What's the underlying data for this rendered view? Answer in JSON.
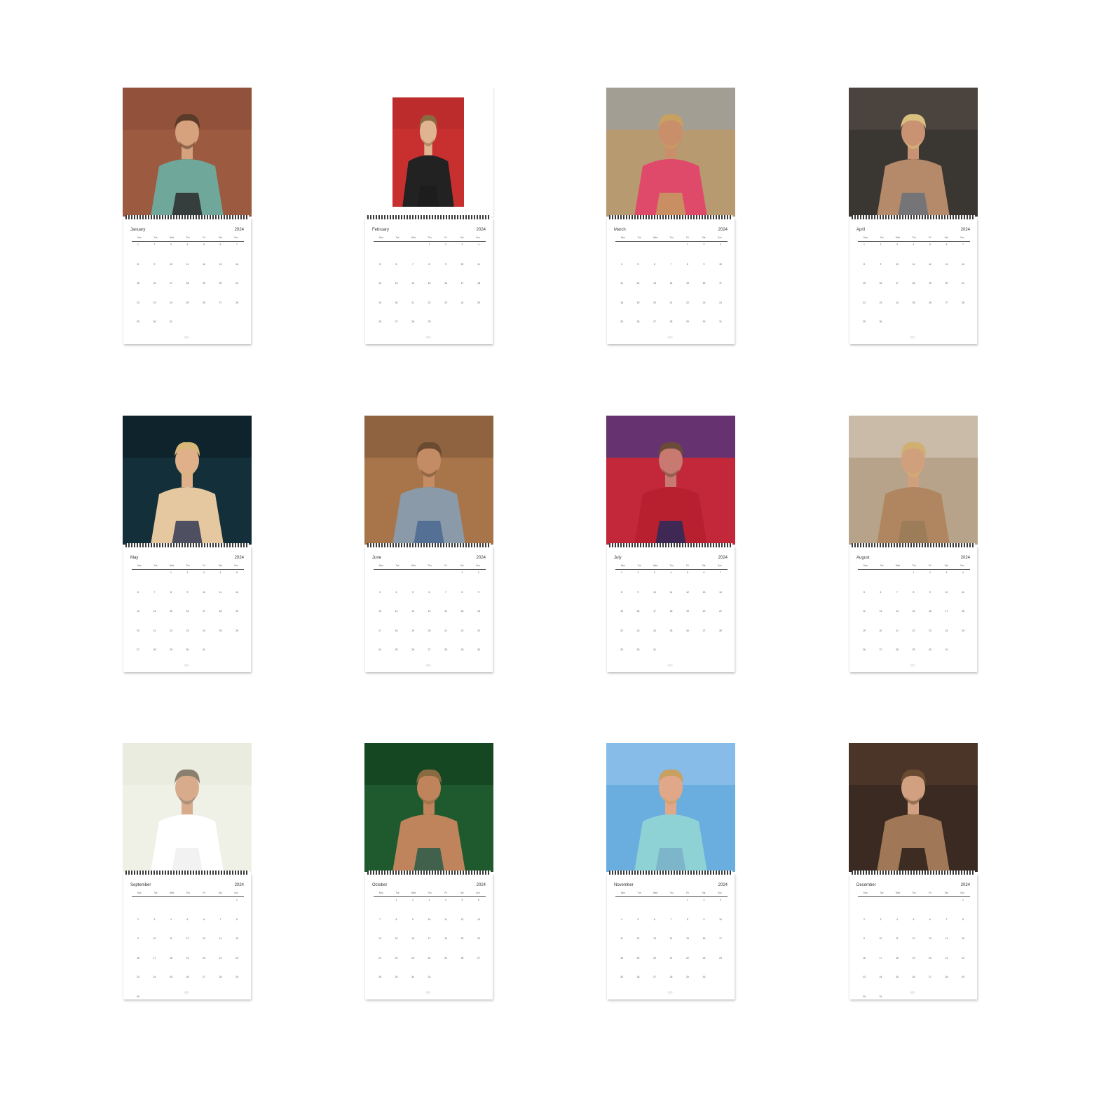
{
  "calendar": {
    "year_label": "2024",
    "weekdays": [
      "Mon",
      "Tue",
      "Wed",
      "Thu",
      "Fri",
      "Sat",
      "Sun"
    ],
    "months": [
      {
        "name": "January",
        "photo": "man in teal shirt against terracotta wall"
      },
      {
        "name": "February",
        "photo": "man in black leather jacket on red backdrop"
      },
      {
        "name": "March",
        "photo": "man in pink shirt and tan coat in desert"
      },
      {
        "name": "April",
        "photo": "shirtless tattooed man in dim room"
      },
      {
        "name": "May",
        "photo": "man in beige blazer and floral shirt at night"
      },
      {
        "name": "June",
        "photo": "man in denim reclining on patterned couch"
      },
      {
        "name": "July",
        "photo": "man in red and blue neon lighting"
      },
      {
        "name": "August",
        "photo": "man in tan suit seated in vintage car"
      },
      {
        "name": "September",
        "photo": "close-up portrait on light background"
      },
      {
        "name": "October",
        "photo": "shirtless man with necklace by palm leaves"
      },
      {
        "name": "November",
        "photo": "man in light blue suit at premiere backdrop"
      },
      {
        "name": "December",
        "photo": "man in camel jacket leaning on dark table"
      }
    ]
  }
}
